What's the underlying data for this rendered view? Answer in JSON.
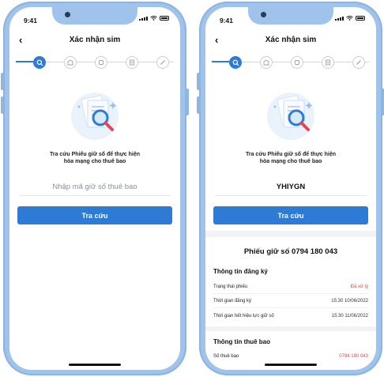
{
  "status": {
    "time": "9:41"
  },
  "left": {
    "nav": {
      "back_icon": "‹",
      "title": "Xác nhận sim"
    },
    "caption_line1": "Tra cứu Phiếu giữ số để thực hiện",
    "caption_line2": "hòa mạng cho thuê bao",
    "code_placeholder": "Nhập mã giữ số thuê bao",
    "search_button": "Tra cứu"
  },
  "right": {
    "nav": {
      "back_icon": "‹",
      "title": "Xác nhận sim"
    },
    "caption_line1": "Tra cứu Phiếu giữ số để thực hiện",
    "caption_line2": "hòa mạng cho thuê bao",
    "code_value": "YHIYGN",
    "search_button": "Tra cứu",
    "result_title": "Phiếu giữ số 0794 180 043",
    "registration": {
      "title": "Thông tin đăng ký",
      "rows": [
        {
          "label": "Trạng thái phiếu",
          "value": "Đã xử lý"
        },
        {
          "label": "Thời gian đăng ký",
          "value": "15:30 10/06/2022"
        },
        {
          "label": "Thời gian hết hiệu lực giữ số",
          "value": "15:30 11/06/2022"
        }
      ]
    },
    "subscriber": {
      "title": "Thông tin thuê bao",
      "rows": [
        {
          "label": "Số thuê bao",
          "value": "0794 180 043"
        }
      ]
    }
  },
  "steps": [
    "search-icon",
    "store-icon",
    "sim-icon",
    "document-icon",
    "pen-icon"
  ],
  "colors": {
    "accent": "#2e7bd6",
    "frame": "#9fc3ea",
    "status_red": "#e0494f"
  }
}
